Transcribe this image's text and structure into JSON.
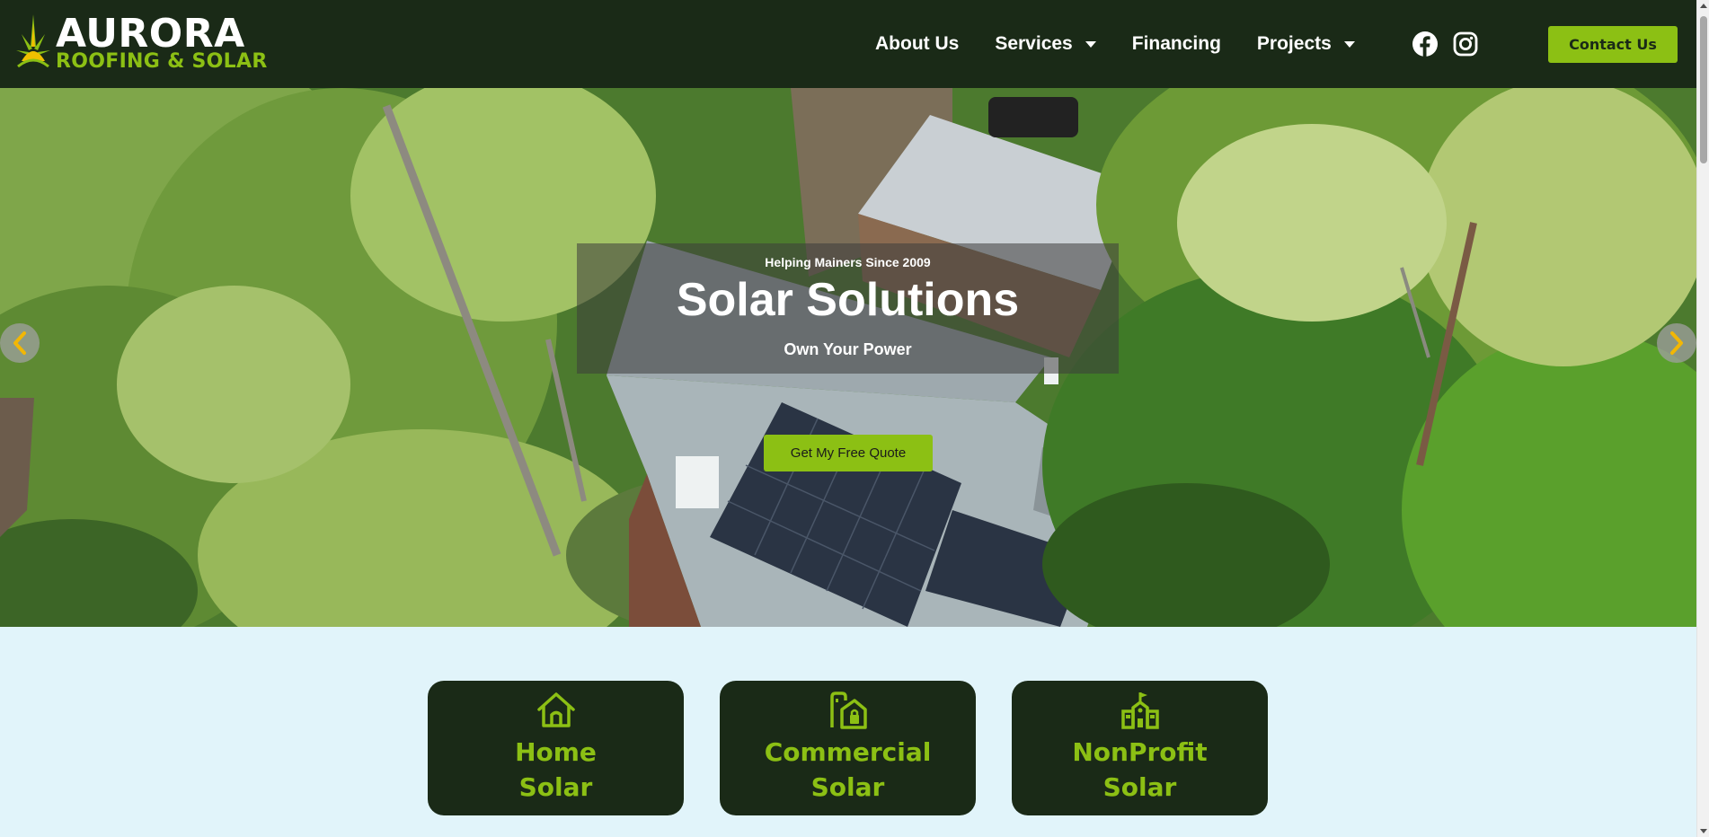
{
  "header": {
    "logo": {
      "name": "AURORA",
      "tagline": "ROOFING & SOLAR"
    },
    "nav": [
      {
        "label": "About Us",
        "has_dropdown": false
      },
      {
        "label": "Services",
        "has_dropdown": true
      },
      {
        "label": "Financing",
        "has_dropdown": false
      },
      {
        "label": "Projects",
        "has_dropdown": true
      }
    ],
    "social_icons": [
      "facebook-icon",
      "instagram-icon"
    ],
    "contact_label": "Contact Us"
  },
  "hero": {
    "kicker": "Helping Mainers Since 2009",
    "title": "Solar Solutions",
    "subtitle": "Own Your Power",
    "cta_label": "Get My Free Quote",
    "prev_icon": "chevron-left-icon",
    "next_icon": "chevron-right-icon"
  },
  "cards": [
    {
      "icon": "house-icon",
      "line1": "Home",
      "line2": "Solar"
    },
    {
      "icon": "commercial-building-icon",
      "line1": "Commercial",
      "line2": "Solar"
    },
    {
      "icon": "school-building-icon",
      "line1": "NonProfit",
      "line2": "Solar"
    }
  ],
  "colors": {
    "header_bg": "#1a2a17",
    "accent": "#8cc014",
    "page_bg": "#e1f4fa",
    "arrow_accent": "#f2b705"
  }
}
